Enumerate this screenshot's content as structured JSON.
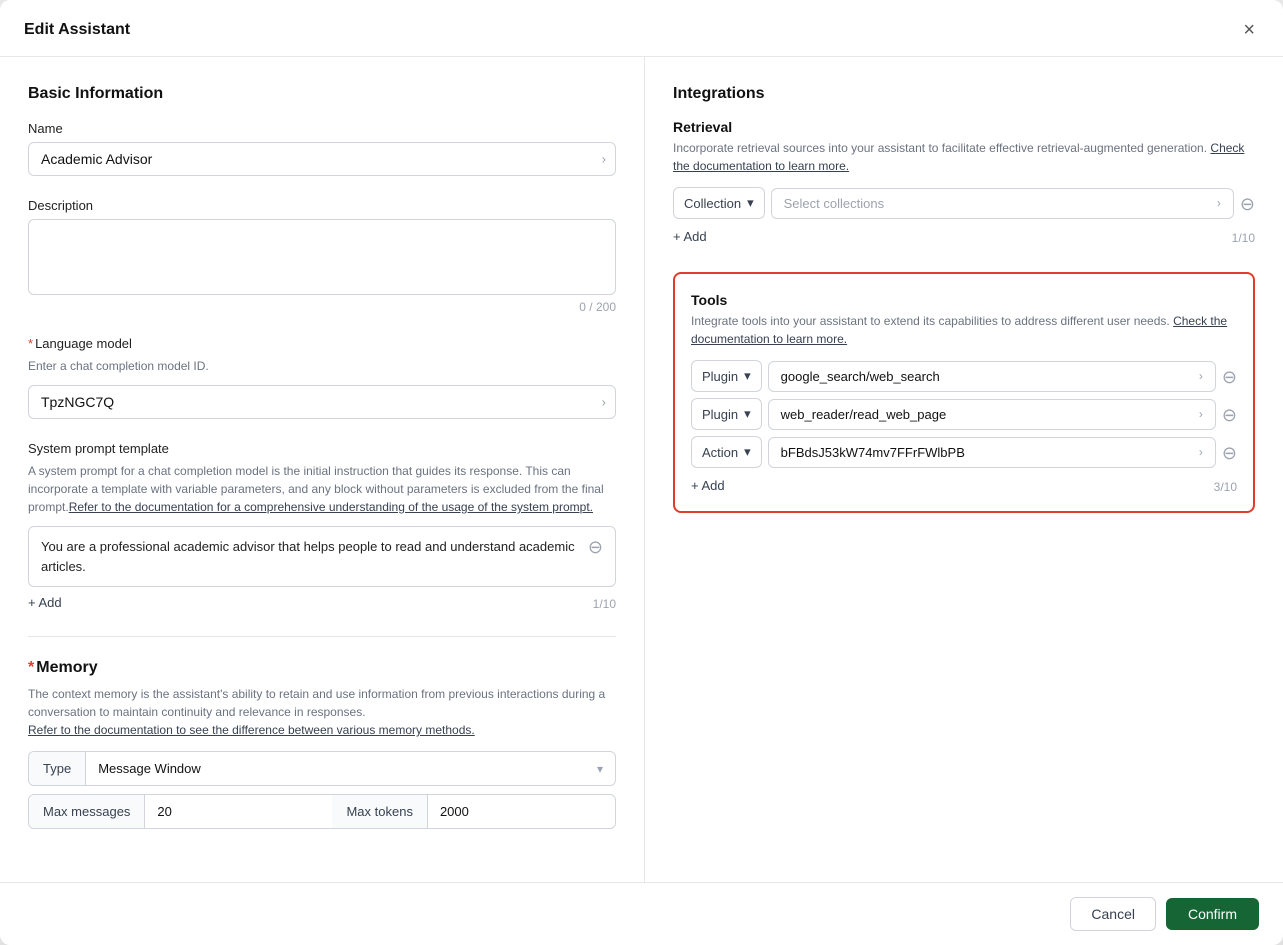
{
  "modal": {
    "title": "Edit Assistant",
    "close_icon": "×"
  },
  "left": {
    "section_title": "Basic Information",
    "name_label": "Name",
    "name_value": "Academic Advisor",
    "description_label": "Description",
    "description_placeholder": "",
    "description_char_count": "0 / 200",
    "language_model_label": "*Language model",
    "language_model_required": "*",
    "language_model_label_text": "Language model",
    "language_model_helper": "Enter a chat completion model ID.",
    "language_model_value": "TpzNGC7Q",
    "system_prompt_label": "System prompt template",
    "system_prompt_helper1": "A system prompt for a chat completion model is the initial instruction that guides its response. This can incorporate a template with variable parameters, and any block without parameters is excluded from the final prompt.",
    "system_prompt_link": "Refer to the documentation for a comprehensive understanding of the usage of the system prompt.",
    "system_prompt_value": "You are a professional academic advisor that helps people to read and understand academic articles.",
    "system_prompt_count": "1/10",
    "add_label": "+ Add",
    "memory_required": "*",
    "memory_label_text": "Memory",
    "memory_helper": "The context memory is the assistant's ability to retain and use information from previous interactions during a conversation to maintain continuity and relevance in responses.",
    "memory_link": "Refer to the documentation to see the difference between various memory methods.",
    "memory_type_label": "Type",
    "memory_type_value": "Message Window",
    "memory_max_messages_label": "Max messages",
    "memory_max_messages_value": "20",
    "memory_max_tokens_label": "Max tokens",
    "memory_max_tokens_value": "2000"
  },
  "right": {
    "section_title": "Integrations",
    "retrieval_title": "Retrieval",
    "retrieval_helper": "Incorporate retrieval sources into your assistant to facilitate effective retrieval-augmented generation.",
    "retrieval_link": "Check the documentation to learn more.",
    "retrieval_type": "Collection",
    "retrieval_placeholder": "Select collections",
    "retrieval_count": "1/10",
    "retrieval_add": "+ Add",
    "tools_title": "Tools",
    "tools_helper": "Integrate tools into your assistant to extend its capabilities to address different user needs.",
    "tools_link": "Check the documentation to learn more.",
    "tools_rows": [
      {
        "type": "Plugin",
        "value": "google_search/web_search"
      },
      {
        "type": "Plugin",
        "value": "web_reader/read_web_page"
      },
      {
        "type": "Action",
        "value": "bFBdsJ53kW74mv7FFrFWlbPB"
      }
    ],
    "tools_count": "3/10",
    "tools_add": "+ Add"
  },
  "footer": {
    "cancel_label": "Cancel",
    "confirm_label": "Confirm"
  }
}
